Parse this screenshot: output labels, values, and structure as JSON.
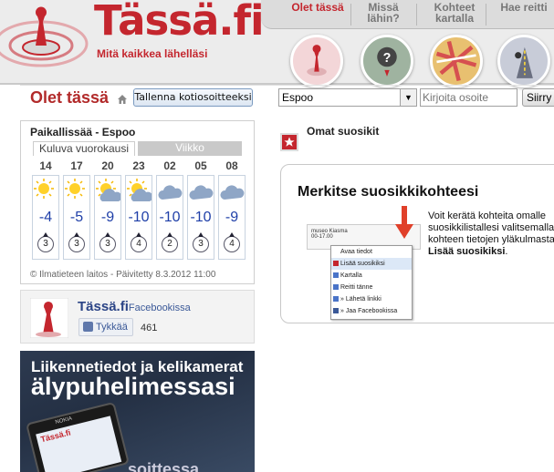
{
  "header": {
    "logo_text": "Tässä.fi",
    "tagline": "Mitä kaikkea lähelläsi",
    "nav": [
      {
        "label": "Olet tässä",
        "active": true
      },
      {
        "label": "Missä lähin?",
        "active": false
      },
      {
        "label": "Kohteet kartalla",
        "active": false
      },
      {
        "label": "Hae reitti",
        "active": false
      }
    ],
    "nav_icons": [
      "pin-icon",
      "question-pin-icon",
      "map-icon",
      "route-icon"
    ]
  },
  "toolbar": {
    "title": "Olet tässä",
    "save_home_label": "Tallenna kotiosoitteeksi",
    "city_value": "Espoo",
    "address_placeholder": "Kirjoita osoite",
    "go_label": "Siirry"
  },
  "weather": {
    "title": "Paikallissää - Espoo",
    "tab_active": "Kuluva vuorokausi",
    "tab_inactive": "Viikko",
    "hours": [
      {
        "hour": "14",
        "icon": "sun-icon",
        "temp": "-4",
        "wind": "3"
      },
      {
        "hour": "17",
        "icon": "sun-icon",
        "temp": "-5",
        "wind": "3"
      },
      {
        "hour": "20",
        "icon": "partly-cloudy-icon",
        "temp": "-9",
        "wind": "3"
      },
      {
        "hour": "23",
        "icon": "partly-cloudy-icon",
        "temp": "-10",
        "wind": "4"
      },
      {
        "hour": "02",
        "icon": "cloud-icon",
        "temp": "-10",
        "wind": "2"
      },
      {
        "hour": "05",
        "icon": "cloud-icon",
        "temp": "-10",
        "wind": "3"
      },
      {
        "hour": "08",
        "icon": "cloud-icon",
        "temp": "-9",
        "wind": "4"
      }
    ],
    "footer": "© Ilmatieteen laitos - Päivitetty 8.3.2012 11:00"
  },
  "facebook": {
    "title": "Tässä.fi",
    "suffix": "Facebookissa",
    "like_label": "Tykkää",
    "count": "461"
  },
  "ad": {
    "line1": "Liikennetiedot ja kelikamerat",
    "line2": "älypuhelimessasi",
    "phone_brand": "NOKIA",
    "phone_logo": "Tässä.fi",
    "line3": "soittessa"
  },
  "favorites": {
    "title": "Omat suosikit",
    "promo_title": "Merkitse suosikkikohteesi",
    "promo_text_pre": "Voit kerätä kohteita omalle suosikkilistallesi valitsemalla kohteen tietojen yläkulmasta ",
    "promo_text_bold": "Lisää suosikiksi",
    "promo_text_post": ".",
    "example_place": "museo Kiasma",
    "example_hours": "00-17.00",
    "menu": [
      "Avaa tiedot",
      "Lisää suosikiksi",
      "Kartalla",
      "Reitti tänne",
      "» Lähetä linkki",
      "» Jaa Facebookissa"
    ]
  },
  "colors": {
    "brand_red": "#c4262e",
    "temp_blue": "#1f3fa8",
    "facebook_blue": "#3b5998"
  }
}
